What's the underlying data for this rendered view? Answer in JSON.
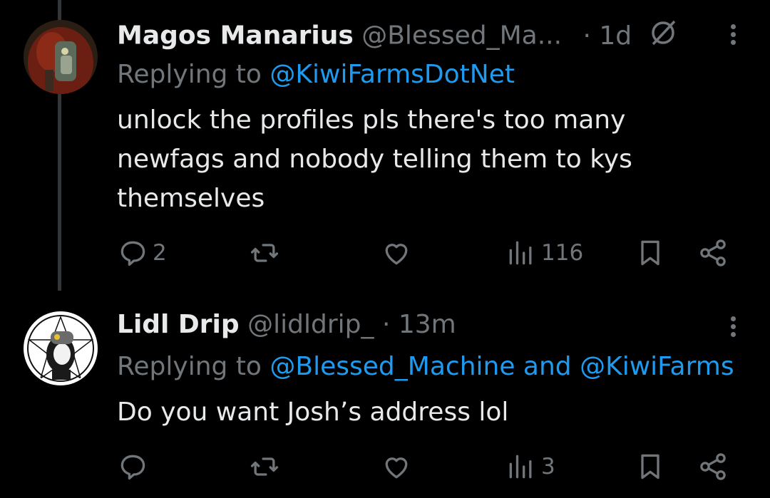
{
  "tweets": [
    {
      "name": "Magos Manarius",
      "handle": "@Blessed_Ma...",
      "time": "· 1d",
      "reply_prefix": "Replying to",
      "reply_to": "@KiwiFarmsDotNet",
      "reply_rest": "",
      "text": "unlock the profiles pls there's too many newfags and nobody telling them to kys themselves",
      "replies": "2",
      "retweets": "",
      "likes": "",
      "views": "116"
    },
    {
      "name": "Lidl Drip",
      "handle": "@lidldrip_",
      "time": "· 13m",
      "reply_prefix": "Replying to",
      "reply_to": "@Blessed_Machine and @KiwiFarms",
      "text": "Do you want Josh’s address lol",
      "replies": "",
      "retweets": "",
      "likes": "",
      "views": "3"
    }
  ],
  "colors": {
    "background": "#000000",
    "text": "#e7e9ea",
    "muted": "#71767b",
    "link": "#1d9bf0",
    "thread_line": "#333639"
  },
  "icons": [
    "reply-icon",
    "retweet-icon",
    "like-icon",
    "views-icon",
    "bookmark-icon",
    "share-icon",
    "more-icon",
    "blocked-icon"
  ]
}
